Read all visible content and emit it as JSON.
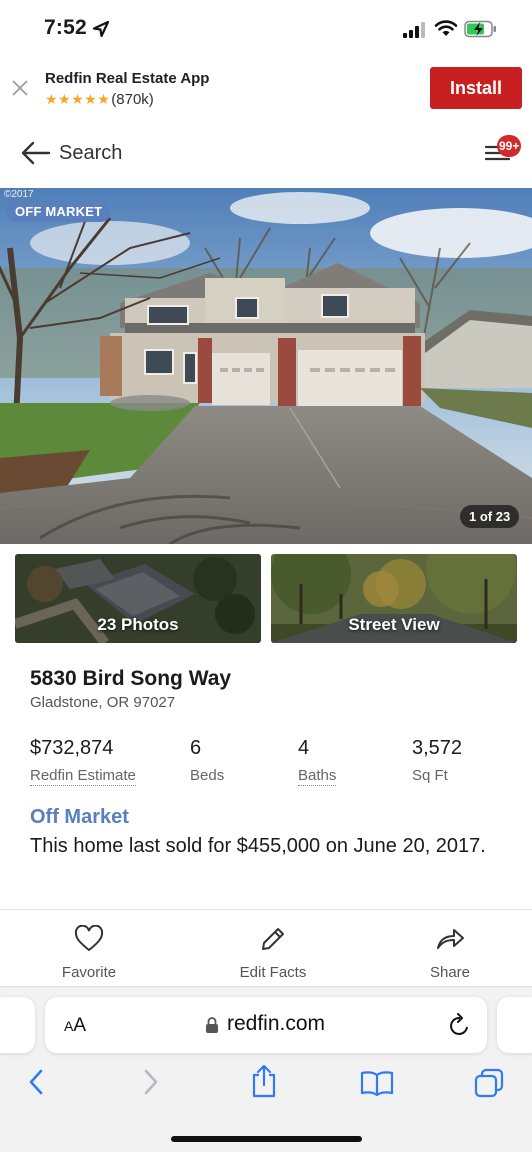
{
  "status_bar": {
    "time": "7:52"
  },
  "app_banner": {
    "title": "Redfin Real Estate App",
    "stars": "★★★★★",
    "rating_count": "(870k)",
    "install_label": "Install"
  },
  "nav": {
    "back_label": "Search",
    "notification_count": "99+"
  },
  "hero": {
    "copyright": "©2017",
    "status_pill": "OFF MARKET",
    "photo_counter": "1 of 23"
  },
  "thumbnails": {
    "photos_label": "23 Photos",
    "street_view_label": "Street View"
  },
  "property": {
    "address": "5830 Bird Song Way",
    "city_state_zip": "Gladstone, OR 97027"
  },
  "stats": [
    {
      "value": "$732,874",
      "label": "Redfin Estimate"
    },
    {
      "value": "6",
      "label": "Beds"
    },
    {
      "value": "4",
      "label": "Baths"
    },
    {
      "value": "3,572",
      "label": "Sq Ft"
    }
  ],
  "sale_info": {
    "heading": "Off Market",
    "text": "This home last sold for $455,000 on June 20, 2017."
  },
  "actions": {
    "favorite": "Favorite",
    "edit_facts": "Edit Facts",
    "share": "Share"
  },
  "browser": {
    "text_size_big": "A",
    "text_size_small": "A",
    "url": "redfin.com"
  },
  "colors": {
    "brand_red": "#c82021",
    "accent_blue": "#5a7fbf",
    "badge_red": "#d02a2a"
  }
}
